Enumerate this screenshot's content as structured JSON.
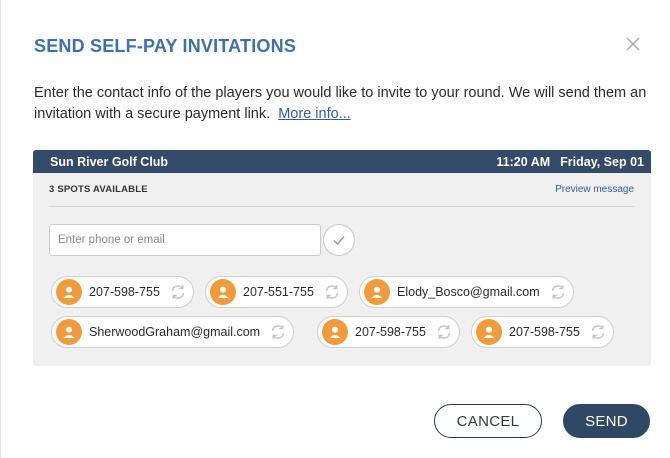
{
  "modal": {
    "title": "SEND SELF-PAY INVITATIONS",
    "close_icon": "close-icon",
    "intro_text": "Enter the contact info of the players you would like to invite to your round. We will send them an invitation with a secure payment link.",
    "more_info_link": "More info..."
  },
  "booking": {
    "course_name": "Sun River Golf Club",
    "time": "11:20 AM",
    "date": "Friday, Sep 01",
    "spots_available": "3 SPOTS AVAILABLE",
    "preview_link": "Preview message"
  },
  "contact_input": {
    "placeholder": "Enter phone or email",
    "value": ""
  },
  "confirm_icon": "check-icon",
  "invitees": [
    {
      "label": "207-598-755",
      "avatar_icon": "user-icon",
      "action_icon": "refresh-icon"
    },
    {
      "label": "207-551-755",
      "avatar_icon": "user-icon",
      "action_icon": "refresh-icon"
    },
    {
      "label": "Elody_Bosco@gmail.com",
      "avatar_icon": "user-icon",
      "action_icon": "refresh-icon"
    },
    {
      "label": "SherwoodGraham@gmail.com",
      "avatar_icon": "user-icon",
      "action_icon": "refresh-icon"
    },
    {
      "label": "207-598-755",
      "avatar_icon": "user-icon",
      "action_icon": "refresh-icon"
    },
    {
      "label": "207-598-755",
      "avatar_icon": "user-icon",
      "action_icon": "refresh-icon"
    }
  ],
  "actions": {
    "cancel_label": "CANCEL",
    "send_label": "SEND"
  },
  "colors": {
    "title": "#3d6fb1",
    "header_bar": "#334a68",
    "avatar": "#f39a3a",
    "send_button": "#2e4866",
    "link": "#2f5fa6"
  }
}
